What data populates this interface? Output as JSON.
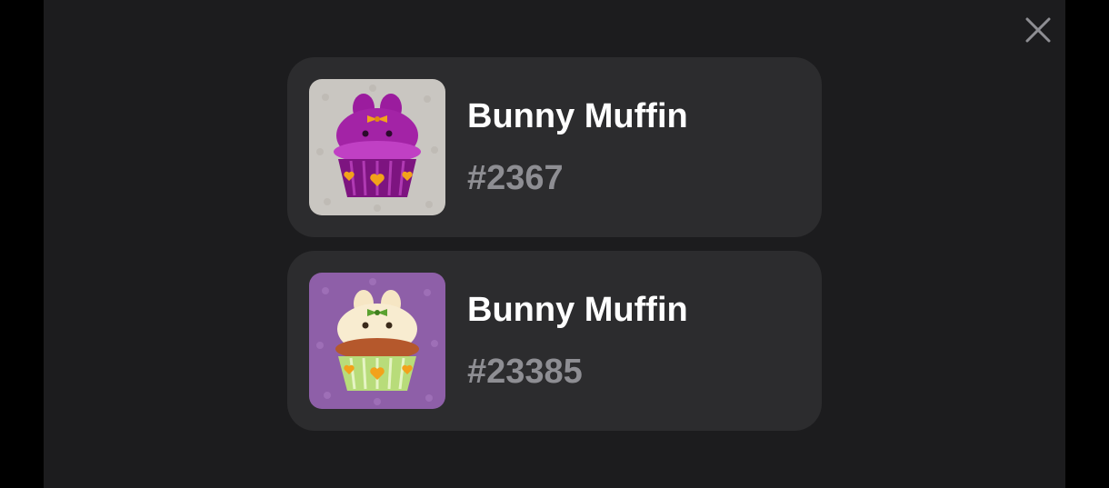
{
  "colors": {
    "page_bg": "#000000",
    "panel_bg": "#1c1c1e",
    "card_bg": "#2c2c2e",
    "title_text": "#ffffff",
    "number_text": "#8e8e93"
  },
  "close": {
    "icon": "close-icon"
  },
  "items": [
    {
      "name": "Bunny Muffin",
      "number": "#2367",
      "image": "purple-bunny-muffin-cupcake",
      "bg": "#c9c6c1"
    },
    {
      "name": "Bunny Muffin",
      "number": "#23385",
      "image": "cream-bunny-muffin-cupcake",
      "bg": "#8e5fa8"
    }
  ]
}
